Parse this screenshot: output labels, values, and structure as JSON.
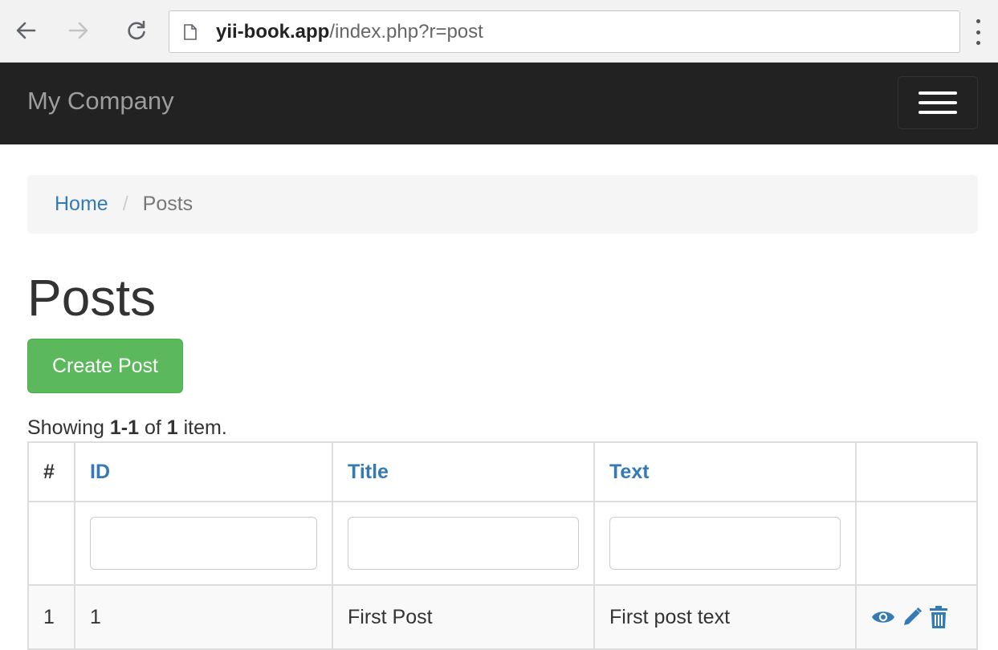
{
  "browser": {
    "url_host": "yii-book.app",
    "url_path": "/index.php?r=post"
  },
  "navbar": {
    "brand": "My Company"
  },
  "breadcrumb": {
    "home": "Home",
    "separator": "/",
    "current": "Posts"
  },
  "page": {
    "title": "Posts",
    "create_button": "Create Post"
  },
  "summary": {
    "prefix": "Showing ",
    "range": "1-1",
    "middle": " of ",
    "total": "1",
    "suffix": " item."
  },
  "table": {
    "headers": [
      "#",
      "ID",
      "Title",
      "Text",
      ""
    ],
    "rows": [
      {
        "index": "1",
        "id": "1",
        "title": "First Post",
        "text": "First post text"
      }
    ]
  },
  "icons": {
    "back": "arrow-left-icon",
    "forward": "arrow-right-icon",
    "reload": "reload-icon",
    "page": "page-icon",
    "menu": "kebab-menu-icon",
    "view": "eye-icon",
    "update": "pencil-icon",
    "delete": "trash-icon"
  },
  "colors": {
    "link": "#337ab7",
    "success": "#5cb85c",
    "navbar": "#222222"
  }
}
